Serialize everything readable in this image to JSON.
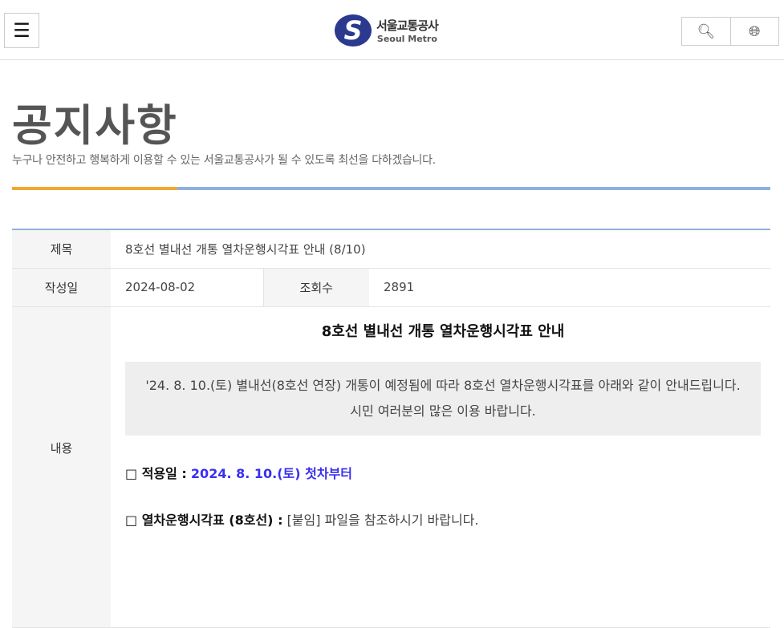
{
  "header": {
    "menu_icon": "hamburger-icon",
    "logo_ko": "서울교통공사",
    "logo_en": "Seoul Metro",
    "search_icon": "search-icon",
    "globe_icon": "globe-icon"
  },
  "page": {
    "title": "공지사항",
    "subtitle": "누구나 안전하고 행복하게 이용할 수 있는 서울교통공사가 될 수 있도록 최선을 다하겠습니다."
  },
  "notice": {
    "subject_label": "제목",
    "subject": "8호선 별내선 개통 열차운행시각표 안내 (8/10)",
    "date_label": "작성일",
    "date": "2024-08-02",
    "views_label": "조회수",
    "views": "2891",
    "content_label": "내용",
    "content": {
      "heading": "8호선 별내선 개통 열차운행시각표 안내",
      "box_line1": "'24. 8. 10.(토) 별내선(8호선 연장) 개통이 예정됨에 따라 8호선 열차운행시각표를 아래와 같이 안내드립니다.",
      "box_line2": "시민 여러분의 많은 이용 바랍니다.",
      "item1_label": "□ 적용일 :",
      "item1_value": "2024. 8. 10.(토) 첫차부터",
      "item2_label": "□ 열차운행시각표 (8호선) :",
      "item2_value": "[붙임] 파일을 참조하시기 바랍니다."
    }
  },
  "colors": {
    "accent_orange": "#f0a830",
    "accent_blue": "#8fb0de",
    "highlight": "#3a2ff0"
  }
}
